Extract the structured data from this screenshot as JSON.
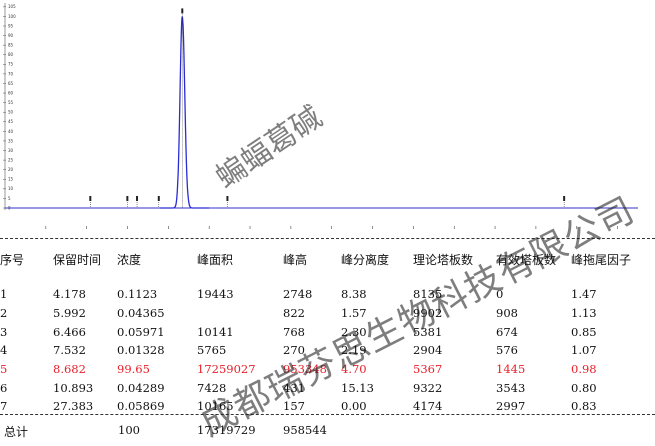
{
  "chart_data": {
    "type": "line",
    "series": [
      {
        "points": [
          [
            8.38,
            0.6
          ],
          [
            8.682,
            100
          ],
          [
            8.98,
            0.7
          ],
          [
            10.893,
            0.9
          ]
        ]
      }
    ],
    "peaks": [
      {
        "no": 1,
        "rt": 4.178,
        "height": 2748
      },
      {
        "no": 2,
        "rt": 5.992,
        "height": 822
      },
      {
        "no": 3,
        "rt": 6.466,
        "height": 768
      },
      {
        "no": 4,
        "rt": 7.532,
        "height": 270
      },
      {
        "no": 5,
        "rt": 8.682,
        "height": 953348
      },
      {
        "no": 6,
        "rt": 10.893,
        "height": 431
      },
      {
        "no": 7,
        "rt": 27.383,
        "height": 157
      }
    ],
    "xlim": [
      0,
      31
    ],
    "ylim": [
      -3,
      107
    ],
    "y_ticks": [
      0,
      5,
      10,
      15,
      20,
      25,
      30,
      35,
      40,
      45,
      50,
      55,
      60,
      65,
      70,
      75,
      80,
      85,
      90,
      95,
      100,
      105
    ],
    "colors": {
      "trace": "#2b2bd6",
      "baseline": "#3030c8",
      "highlight": "#e8202a"
    }
  },
  "table": {
    "headers": [
      "序号",
      "保留时间",
      "浓度",
      "峰面积",
      "峰高",
      "峰分离度",
      "理论塔板数",
      "有效塔板数",
      "峰拖尾因子"
    ],
    "rows": [
      [
        "1",
        "4.178",
        "0.1123",
        "19443",
        "2748",
        "8.38",
        "8135",
        "0",
        "1.47"
      ],
      [
        "2",
        "5.992",
        "0.04365",
        "",
        "822",
        "1.57",
        "9902",
        "908",
        "1.13"
      ],
      [
        "3",
        "6.466",
        "0.05971",
        "10141",
        "768",
        "2.30",
        "5381",
        "674",
        "0.85"
      ],
      [
        "4",
        "7.532",
        "0.01328",
        "5765",
        "270",
        "2.19",
        "2904",
        "576",
        "1.07"
      ],
      [
        "5",
        "8.682",
        "99.65",
        "17259027",
        "953348",
        "4.70",
        "5367",
        "1445",
        "0.98"
      ],
      [
        "6",
        "10.893",
        "0.04289",
        "7428",
        "431",
        "15.13",
        "9322",
        "3543",
        "0.80"
      ],
      [
        "7",
        "27.383",
        "0.05869",
        "10165",
        "157",
        "0.00",
        "4174",
        "2997",
        "0.83"
      ]
    ],
    "highlight_row": 4,
    "total": {
      "label": "总计",
      "concentration": "100",
      "area": "17319729",
      "height": "958544"
    }
  },
  "watermarks": {
    "line1": "蝙蝠葛碱",
    "line2": "成都瑞芬思生物科技有限公司"
  }
}
